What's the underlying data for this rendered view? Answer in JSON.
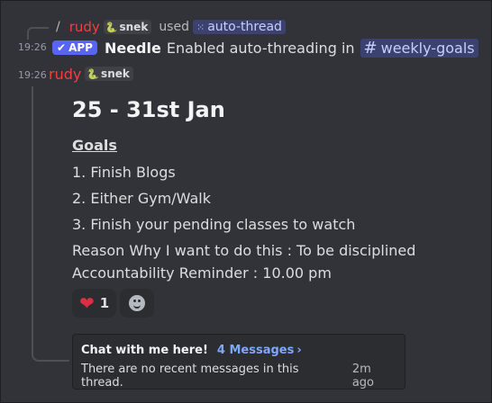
{
  "command_line": {
    "slash": "/",
    "user": "rudy",
    "tag": "snek",
    "used": "used",
    "command": "auto-thread"
  },
  "app_message": {
    "time": "19:26",
    "badge": "APP",
    "name": "Needle",
    "text": "Enabled auto-threading in",
    "channel": "weekly-goals"
  },
  "user_message": {
    "time": "19:26",
    "name": "rudy",
    "tag": "snek",
    "heading": "25 - 31st Jan",
    "goals_title": "Goals",
    "goals": [
      "1. Finish Blogs",
      "2. Either Gym/Walk",
      "3. Finish your pending classes to watch"
    ],
    "reason": "Reason Why I want to do this : To be disciplined",
    "reminder": "Accountability Reminder : 10.00 pm"
  },
  "reactions": {
    "heart_count": "1"
  },
  "thread": {
    "title": "Chat with me here!",
    "messages_link": "4 Messages",
    "link_chevron": "›",
    "empty_text": "There are no recent messages in this thread.",
    "ago": "2m ago"
  },
  "colors": {
    "background": "#313338",
    "username": "#f23f43",
    "app_badge": "#5865f2",
    "mention_bg": "#3c4270",
    "link": "#7ea7ff"
  }
}
